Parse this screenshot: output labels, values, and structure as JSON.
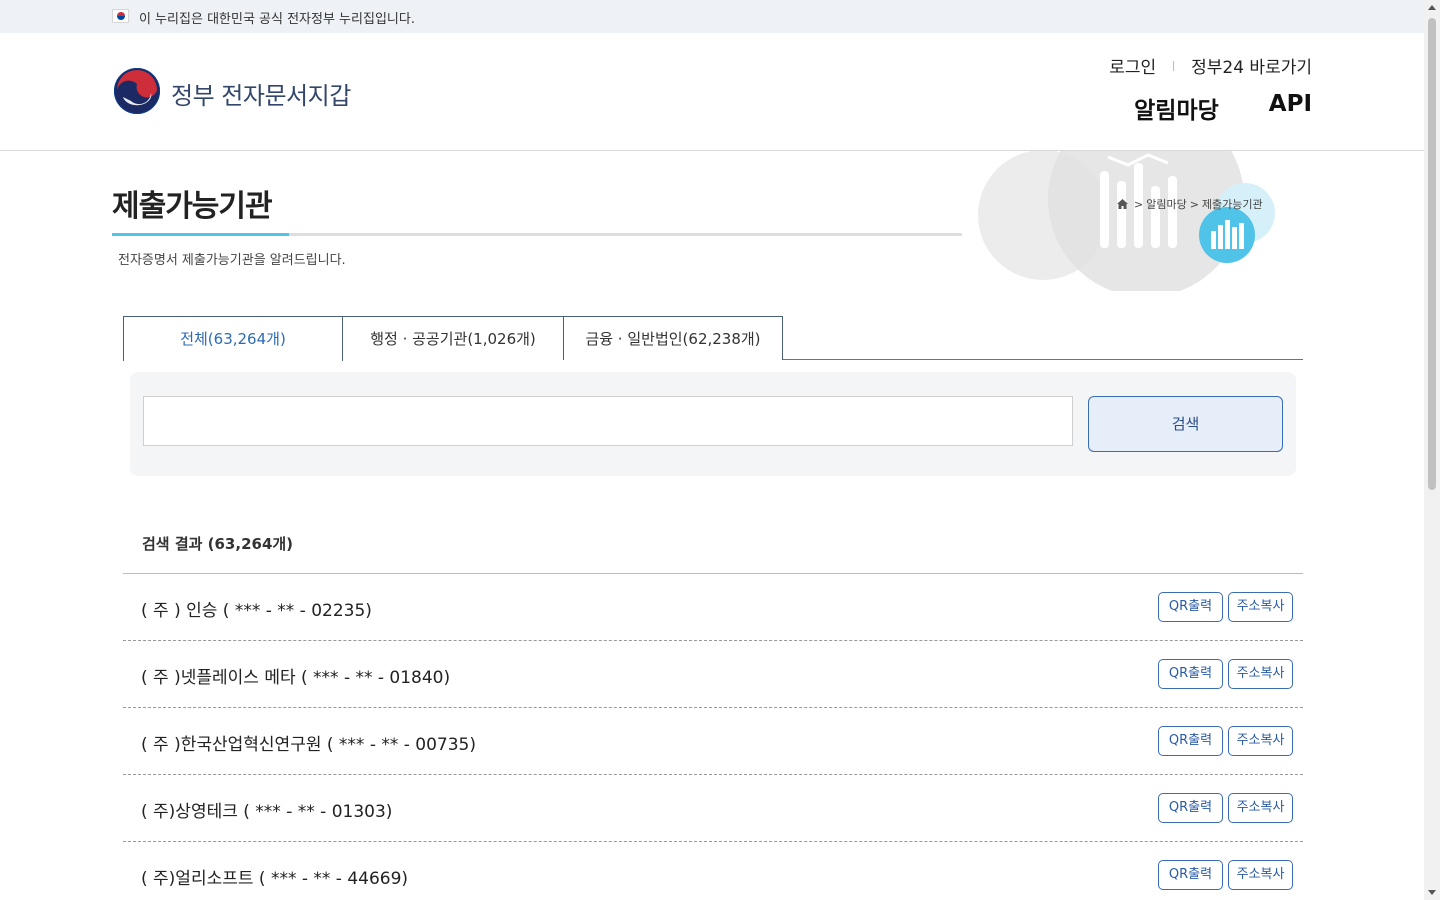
{
  "gov_banner": {
    "text": "이 누리집은 대한민국 공식 전자정부 누리집입니다."
  },
  "header": {
    "site_title": "정부 전자문서지갑",
    "util_links": {
      "login": "로그인",
      "gov24": "정부24 바로가기"
    },
    "nav": {
      "notice": "알림마당",
      "api": "API"
    }
  },
  "page": {
    "title": "제출가능기관",
    "description": "전자증명서 제출가능기관을 알려드립니다.",
    "breadcrumb": {
      "arrow": ">",
      "level1": "알림마당",
      "level2": "제출가능기관"
    }
  },
  "tabs": [
    {
      "label": "전체(63,264개)",
      "active": true
    },
    {
      "label": "행정 · 공공기관(1,026개)",
      "active": false
    },
    {
      "label": "금융 · 일반법인(62,238개)",
      "active": false
    }
  ],
  "search": {
    "value": "",
    "placeholder": "",
    "button_label": "검색"
  },
  "results": {
    "count_label": "검색 결과 (63,264개)",
    "qr_label": "QR출력",
    "copy_label": "주소복사",
    "items": [
      {
        "name": "( 주 ) 인승 (  ***   -   **   - 02235)"
      },
      {
        "name": "( 주 )넷플레이스 메타 (  ***   -   **   - 01840)"
      },
      {
        "name": "( 주 )한국산업혁신연구원 (  ***   -   **   - 00735)"
      },
      {
        "name": "( 주)상영테크 (  ***   -   **   - 01303)"
      },
      {
        "name": "( 주)얼리소프트 (  ***   -   **   - 44669)"
      }
    ]
  },
  "colors": {
    "accent": "#4fc3e8",
    "brand": "#34476b",
    "link_blue": "#2a5ba6"
  }
}
